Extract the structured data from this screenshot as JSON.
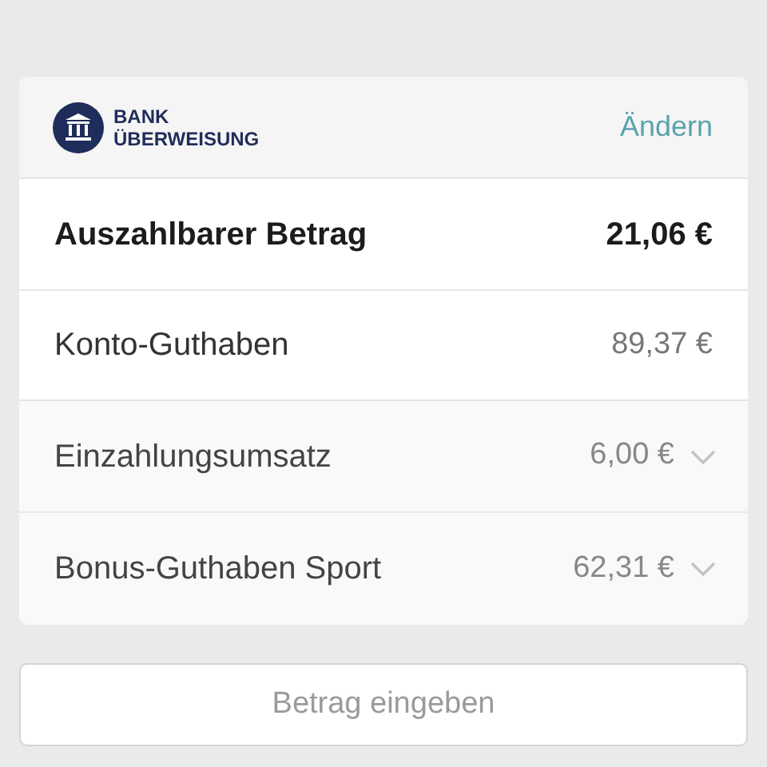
{
  "payment_method": {
    "line_1": "BANK",
    "line_2": "ÜBERWEISUNG",
    "change_link": "Ändern"
  },
  "rows": [
    {
      "kind": "total",
      "label": "Auszahlbarer Betrag",
      "amount": "21,06 €"
    },
    {
      "kind": "plain",
      "label": "Konto-Guthaben",
      "amount": "89,37 €"
    },
    {
      "kind": "expandable",
      "label": "Einzahlungsumsatz",
      "amount": "6,00 €",
      "expanded": false
    },
    {
      "kind": "expandable",
      "label": "Bonus-Guthaben Sport",
      "amount": "62,31 €",
      "expanded": false
    }
  ],
  "amount_field": {
    "placeholder": "Betrag eingeben"
  }
}
